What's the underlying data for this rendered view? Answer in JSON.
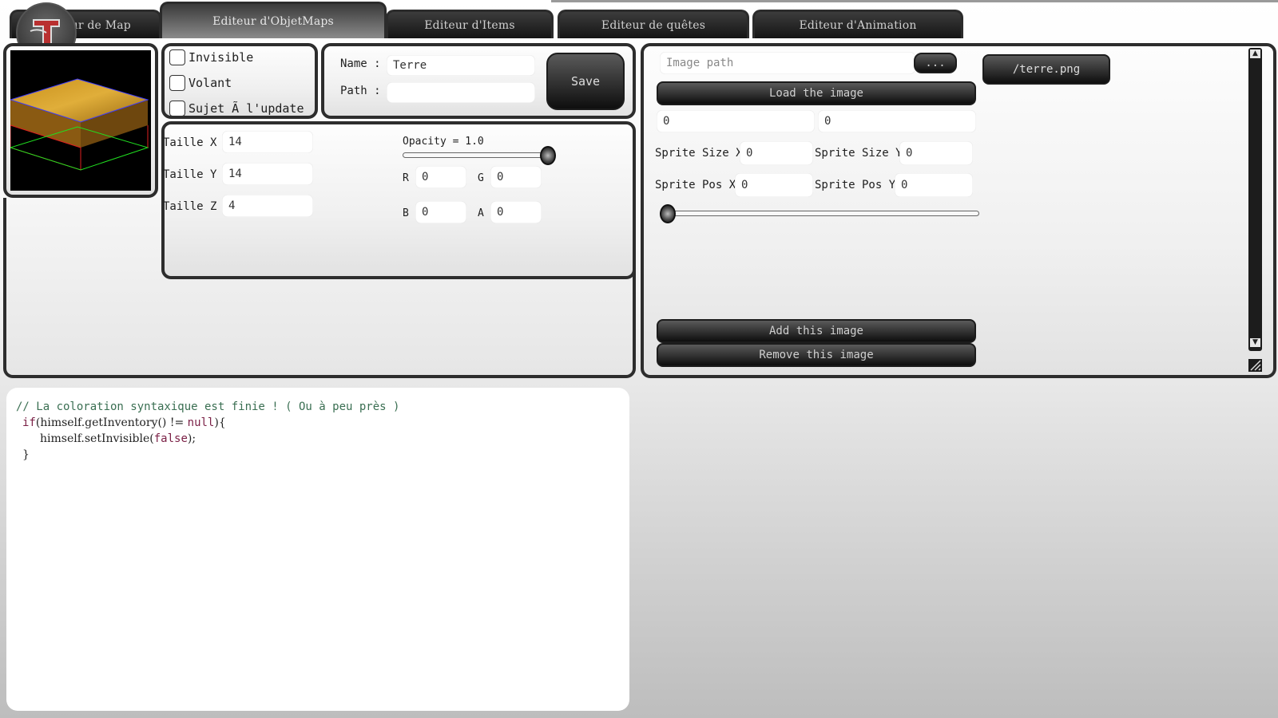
{
  "tabs": [
    {
      "label": "Editeur de Map",
      "active": false
    },
    {
      "label": "Editeur d'ObjetMaps",
      "active": true
    },
    {
      "label": "Editeur d'Items",
      "active": false
    },
    {
      "label": "Editeur de quêtes",
      "active": false
    },
    {
      "label": "Editeur d'Animation",
      "active": false
    }
  ],
  "flags": {
    "invisible": "Invisible",
    "volant": "Volant",
    "sujet": "Sujet Ã  l'update"
  },
  "identity": {
    "name_label": "Name :",
    "name_value": "Terre",
    "path_label": "Path :",
    "path_value": "",
    "save_label": "Save"
  },
  "size": {
    "x_label": "Taille X",
    "x_value": "14",
    "y_label": "Taille Y",
    "y_value": "14",
    "z_label": "Taille Z",
    "z_value": "4"
  },
  "color": {
    "opacity_label": "Opacity = 1.0",
    "opacity": 1.0,
    "r_label": "R",
    "r_value": "0",
    "g_label": "G",
    "g_value": "0",
    "b_label": "B",
    "b_value": "0",
    "a_label": "A",
    "a_value": "0"
  },
  "image": {
    "path_placeholder": "Image path",
    "browse_label": "...",
    "load_label": "Load the image",
    "field1": "0",
    "field2": "0",
    "sprite_size_x_label": "Sprite Size X",
    "sprite_size_x": "0",
    "sprite_size_y_label": "Sprite Size Y",
    "sprite_size_y": "0",
    "sprite_pos_x_label": "Sprite Pos X",
    "sprite_pos_x": "0",
    "sprite_pos_y_label": "Sprite Pos Y",
    "sprite_pos_y": "0",
    "slider_value": 0,
    "add_label": "Add this image",
    "remove_label": "Remove this image",
    "list_item": "/terre.png"
  },
  "code": {
    "comment": "// La coloration syntaxique est finie ! ( Ou à peu près )",
    "l2_kw": "if",
    "l2_a": "(himself.getInventory() != ",
    "l2_null": "null",
    "l2_b": "){",
    "l3_a": "himself.setInvisible(",
    "l3_false": "false",
    "l3_b": ");",
    "l4": "}"
  },
  "colors": {
    "accent_dark": "#1c1c1c",
    "panel_border": "#2d2d2d",
    "code_comment": "#3a6f52",
    "code_keyword": "#7a1f45"
  }
}
